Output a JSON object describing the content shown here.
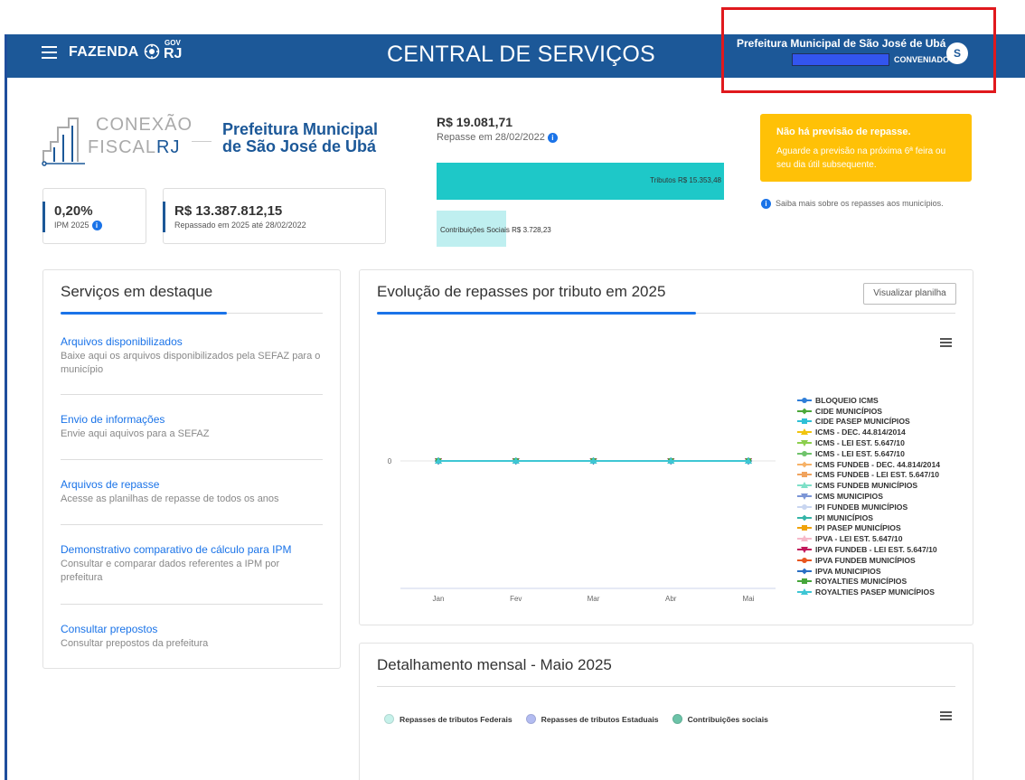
{
  "header": {
    "brand": "FAZENDA",
    "brand_gov": "GOV",
    "brand_rj": "RJ",
    "title": "CENTRAL DE SERVIÇOS",
    "municipality": "Prefeitura Municipal de São José de Ubá",
    "role": "CONVENIADO",
    "avatar_letter": "S"
  },
  "logo": {
    "line1": "CONEXÃO",
    "line2_a": "FISCAL",
    "line2_b": "RJ"
  },
  "municipality_title": "Prefeitura Municipal de São José de Ubá",
  "kpis": {
    "ipm_value": "0,20%",
    "ipm_label": "IPM 2025",
    "repassado_value": "R$ 13.387.812,15",
    "repassado_label": "Repassado em 2025 até 28/02/2022"
  },
  "repasse": {
    "value": "R$ 19.081,71",
    "date_label": "Repasse em 28/02/2022",
    "tributos_label": "Tributos R$ 15.353,48",
    "tributos_value": 15353.48,
    "contrib_label": "Contribuições Sociais R$ 3.728,23",
    "contrib_value": 3728.23,
    "tributos_color": "#1ec8c8",
    "contrib_color": "#bfeff0"
  },
  "alert": {
    "title": "Não há previsão de repasse.",
    "body": "Aguarde a previsão na próxima 6ª feira ou seu dia útil subsequente.",
    "link": "Saiba mais sobre os repasses aos municípios.",
    "color": "#ffc107"
  },
  "services": {
    "title": "Serviços em destaque",
    "items": [
      {
        "title": "Arquivos disponibilizados",
        "desc": "Baixe aqui os arquivos disponibilizados pela SEFAZ para o município"
      },
      {
        "title": "Envio de informações",
        "desc": "Envie aqui aquivos para a SEFAZ"
      },
      {
        "title": "Arquivos de repasse",
        "desc": "Acesse as planilhas de repasse de todos os anos"
      },
      {
        "title": "Demonstrativo comparativo de cálculo para IPM",
        "desc": "Consultar e comparar dados referentes a IPM por prefeitura"
      },
      {
        "title": "Consultar prepostos",
        "desc": "Consultar prepostos da prefeitura"
      }
    ]
  },
  "evolution": {
    "title": "Evolução de repasses por tributo em 2025",
    "button": "Visualizar planilha"
  },
  "chart_data": {
    "type": "line",
    "x": [
      "Jan",
      "Fev",
      "Mar",
      "Abr",
      "Mai"
    ],
    "yticks": [
      "0"
    ],
    "series": [
      {
        "name": "BLOQUEIO ICMS",
        "values": [
          0,
          0,
          0,
          0,
          0
        ],
        "color": "#2f7ed8",
        "marker": "circle"
      },
      {
        "name": "CIDE MUNICÍPIOS",
        "values": [
          0,
          0,
          0,
          0,
          0
        ],
        "color": "#4ca839",
        "marker": "diamond"
      },
      {
        "name": "CIDE PASEP MUNICÍPIOS",
        "values": [
          0,
          0,
          0,
          0,
          0
        ],
        "color": "#2ec0d6",
        "marker": "square"
      },
      {
        "name": "ICMS - DEC. 44.814/2014",
        "values": [
          0,
          0,
          0,
          0,
          0
        ],
        "color": "#f1c40f",
        "marker": "triangle"
      },
      {
        "name": "ICMS - LEI EST. 5.647/10",
        "values": [
          0,
          0,
          0,
          0,
          0
        ],
        "color": "#8ccf4d",
        "marker": "triangle-down"
      },
      {
        "name": "ICMS - LEI EST. 5.647/10",
        "values": [
          0,
          0,
          0,
          0,
          0
        ],
        "color": "#6fc36b",
        "marker": "circle"
      },
      {
        "name": "ICMS FUNDEB - DEC. 44.814/2014",
        "values": [
          0,
          0,
          0,
          0,
          0
        ],
        "color": "#f7b267",
        "marker": "diamond"
      },
      {
        "name": "ICMS FUNDEB - LEI EST. 5.647/10",
        "values": [
          0,
          0,
          0,
          0,
          0
        ],
        "color": "#f0a35e",
        "marker": "square"
      },
      {
        "name": "ICMS FUNDEB MUNICÍPIOS",
        "values": [
          0,
          0,
          0,
          0,
          0
        ],
        "color": "#7ee0c8",
        "marker": "triangle"
      },
      {
        "name": "ICMS MUNICIPIOS",
        "values": [
          0,
          0,
          0,
          0,
          0
        ],
        "color": "#7b95d6",
        "marker": "triangle-down"
      },
      {
        "name": "IPI FUNDEB MUNICÍPIOS",
        "values": [
          0,
          0,
          0,
          0,
          0
        ],
        "color": "#c9d6f0",
        "marker": "circle"
      },
      {
        "name": "IPI MUNICÍPIOS",
        "values": [
          0,
          0,
          0,
          0,
          0
        ],
        "color": "#35b5a8",
        "marker": "diamond"
      },
      {
        "name": "IPI PASEP MUNICÍPIOS",
        "values": [
          0,
          0,
          0,
          0,
          0
        ],
        "color": "#f0a30a",
        "marker": "square"
      },
      {
        "name": "IPVA - LEI EST. 5.647/10",
        "values": [
          0,
          0,
          0,
          0,
          0
        ],
        "color": "#f6b8c8",
        "marker": "triangle"
      },
      {
        "name": "IPVA FUNDEB - LEI EST. 5.647/10",
        "values": [
          0,
          0,
          0,
          0,
          0
        ],
        "color": "#c2185b",
        "marker": "triangle-down"
      },
      {
        "name": "IPVA FUNDEB MUNICÍPIOS",
        "values": [
          0,
          0,
          0,
          0,
          0
        ],
        "color": "#e8561f",
        "marker": "circle"
      },
      {
        "name": "IPVA MUNICIPIOS",
        "values": [
          0,
          0,
          0,
          0,
          0
        ],
        "color": "#2a6fc4",
        "marker": "diamond"
      },
      {
        "name": "ROYALTIES MUNICÍPIOS",
        "values": [
          0,
          0,
          0,
          0,
          0
        ],
        "color": "#46a63a",
        "marker": "square"
      },
      {
        "name": "ROYALTIES PASEP MUNICÍPIOS",
        "values": [
          0,
          0,
          0,
          0,
          0
        ],
        "color": "#3ec6d4",
        "marker": "triangle"
      }
    ]
  },
  "detail": {
    "title": "Detalhamento mensal - Maio 2025",
    "legend": [
      {
        "label": "Repasses de tributos Federais",
        "color": "#c6f1ea"
      },
      {
        "label": "Repasses de tributos Estaduais",
        "color": "#b3bcf1"
      },
      {
        "label": "Contribuições sociais",
        "color": "#6cc3a8"
      }
    ]
  }
}
